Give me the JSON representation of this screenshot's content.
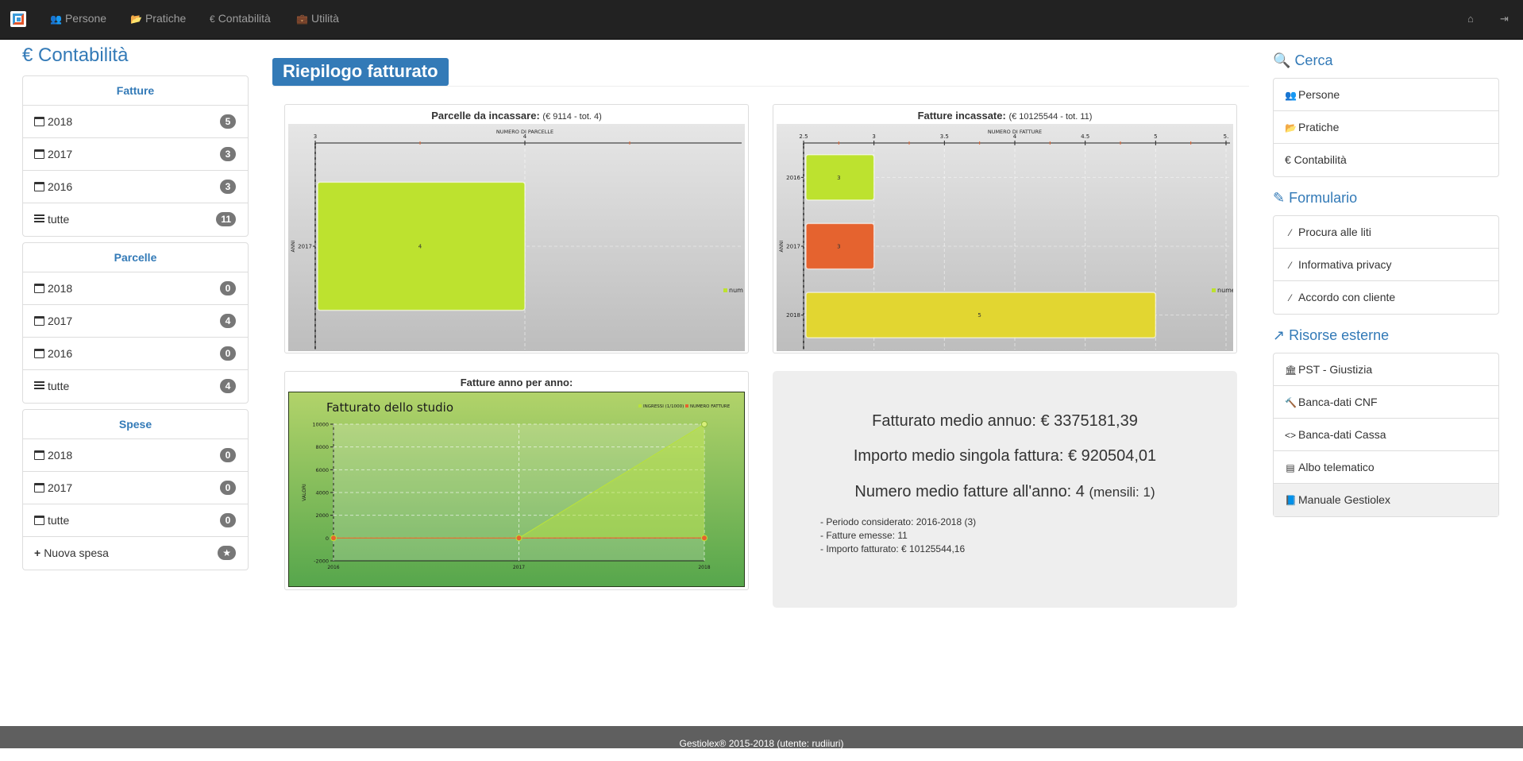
{
  "nav": {
    "items": [
      {
        "label": "Persone",
        "icon": "users-icon"
      },
      {
        "label": "Pratiche",
        "icon": "folder-open-icon"
      },
      {
        "label": "Contabilità",
        "icon": "euro-icon"
      },
      {
        "label": "Utilità",
        "icon": "briefcase-icon"
      }
    ],
    "right_icons": [
      "home-icon",
      "logout-icon"
    ]
  },
  "left": {
    "title": "€ Contabilità",
    "panels": [
      {
        "header": "Fatture",
        "rows": [
          {
            "label": "2018",
            "count": "5",
            "icon": "calendar-icon"
          },
          {
            "label": "2017",
            "count": "3",
            "icon": "calendar-icon"
          },
          {
            "label": "2016",
            "count": "3",
            "icon": "calendar-icon"
          },
          {
            "label": "tutte",
            "count": "11",
            "icon": "list-icon"
          }
        ]
      },
      {
        "header": "Parcelle",
        "rows": [
          {
            "label": "2018",
            "count": "0",
            "icon": "calendar-icon"
          },
          {
            "label": "2017",
            "count": "4",
            "icon": "calendar-icon"
          },
          {
            "label": "2016",
            "count": "0",
            "icon": "calendar-icon"
          },
          {
            "label": "tutte",
            "count": "4",
            "icon": "list-icon"
          }
        ]
      },
      {
        "header": "Spese",
        "rows": [
          {
            "label": "2018",
            "count": "0",
            "icon": "calendar-icon"
          },
          {
            "label": "2017",
            "count": "0",
            "icon": "calendar-icon"
          },
          {
            "label": "tutte",
            "count": "0",
            "icon": "calendar-icon"
          },
          {
            "label": "Nuova spesa",
            "count": "★",
            "icon": "plus-icon"
          }
        ]
      }
    ]
  },
  "main": {
    "heading": "Riepilogo fatturato",
    "parcelle": {
      "title": "Parcelle da incassare:",
      "detail": "(€ 9114 - tot. 4)"
    },
    "fatture": {
      "title": "Fatture incassate:",
      "detail": "(€ 10125544 - tot. 11)"
    },
    "annuale": {
      "title": "Fatture anno per anno:"
    },
    "stats": {
      "medio_annuo": "Fatturato medio annuo: € 3375181,39",
      "medio_fattura": "Importo medio singola fattura: € 920504,01",
      "numero_medio": "Numero medio fatture all'anno: 4",
      "mensili": "(mensili: 1)",
      "periodo": "- Periodo considerato: 2016-2018 (3)",
      "emesse": "- Fatture emesse: 11",
      "importo": "- Importo fatturato: € 10125544,16"
    }
  },
  "chart_data": [
    {
      "type": "bar",
      "orientation": "horizontal",
      "title": "",
      "xlabel": "NUMERO DI PARCELLE",
      "ylabel": "ANNI",
      "categories": [
        "2017"
      ],
      "series": [
        {
          "name": "num",
          "values": [
            4
          ]
        }
      ],
      "data_labels": [
        "4"
      ],
      "xlim": [
        3,
        5
      ],
      "x_ticks": [
        "3",
        "4"
      ],
      "colors": [
        "#bde22f"
      ],
      "legend": "right"
    },
    {
      "type": "bar",
      "orientation": "horizontal",
      "title": "",
      "xlabel": "NUMERO DI FATTURE",
      "ylabel": "ANNI",
      "categories": [
        "2016",
        "2017",
        "2018"
      ],
      "series": [
        {
          "name": "numero",
          "values": [
            3,
            3,
            5
          ]
        }
      ],
      "data_labels": [
        "3",
        "3",
        "5"
      ],
      "xlim": [
        2.5,
        5.5
      ],
      "x_ticks": [
        "2.5",
        "3",
        "3.5",
        "4",
        "4.5",
        "5",
        "5."
      ],
      "colors": [
        "#bde22f",
        "#e5632f",
        "#e2d631"
      ],
      "legend": "right"
    },
    {
      "type": "line",
      "title": "Fatturato dello studio",
      "xlabel": "",
      "ylabel": "VALORI",
      "x": [
        "2016",
        "2017",
        "2018"
      ],
      "series": [
        {
          "name": "INGRESSI (1/1000)",
          "values": [
            0,
            0,
            10000
          ],
          "color": "#b9e23a"
        },
        {
          "name": "NUMERO FATTURE",
          "values": [
            3,
            3,
            5
          ],
          "color": "#e5632f"
        }
      ],
      "ylim": [
        -2000,
        10000
      ],
      "y_ticks": [
        "10000",
        "8000",
        "6000",
        "4000",
        "2000",
        "0",
        "-2000"
      ],
      "legend": "top-right"
    }
  ],
  "right": {
    "cerca": {
      "title": "Cerca",
      "items": [
        "Persone",
        "Pratiche",
        "€ Contabilità"
      ]
    },
    "formulario": {
      "title": "Formulario",
      "items": [
        "Procura alle liti",
        "Informativa privacy",
        "Accordo con cliente"
      ]
    },
    "risorse": {
      "title": "Risorse esterne",
      "items": [
        "PST - Giustizia",
        "Banca-dati CNF",
        "Banca-dati Cassa",
        "Albo telematico",
        "Manuale Gestiolex"
      ]
    }
  },
  "footer": {
    "text": "Gestiolex® 2015-2018 (utente: rudiiuri)"
  }
}
